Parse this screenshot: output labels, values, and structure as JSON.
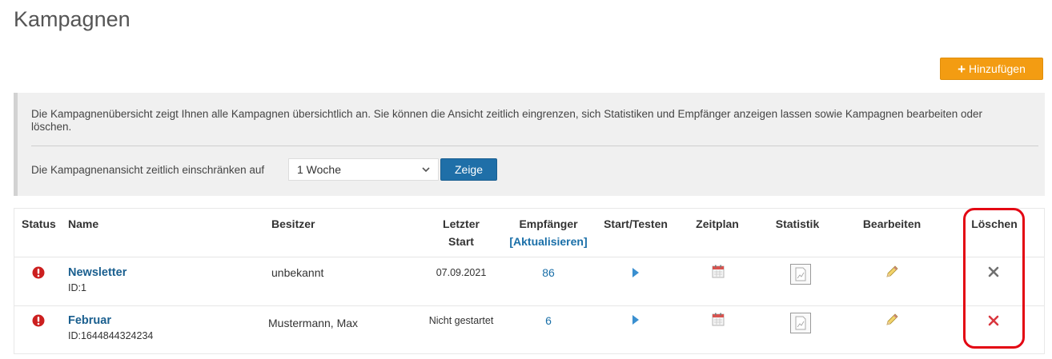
{
  "page": {
    "title": "Kampagnen"
  },
  "toolbar": {
    "add_label": "Hinzufügen"
  },
  "info": {
    "description": "Die Kampagnenübersicht zeigt Ihnen alle Kampagnen übersichtlich an. Sie können die Ansicht zeitlich eingrenzen, sich Statistiken und Empfänger anzeigen lassen sowie Kampagnen bearbeiten oder löschen.",
    "filter_label": "Die Kampagnenansicht zeitlich einschränken auf",
    "filter_value": "1 Woche",
    "show_label": "Zeige"
  },
  "table": {
    "headers": {
      "status": "Status",
      "name": "Name",
      "owner": "Besitzer",
      "last_start": "Letzter Start",
      "recipients": "Empfänger",
      "refresh": "[Aktualisieren]",
      "start_test": "Start/Testen",
      "schedule": "Zeitplan",
      "statistics": "Statistik",
      "edit": "Bearbeiten",
      "delete": "Löschen"
    },
    "rows": [
      {
        "name": "Newsletter",
        "id": "ID:1",
        "owner": "unbekannt",
        "last_start": "07.09.2021",
        "recipients": "86"
      },
      {
        "name": "Februar",
        "id": "ID:1644844324234",
        "owner": "Mustermann, Max",
        "last_start": "Nicht gestartet",
        "recipients": "6"
      }
    ]
  },
  "colors": {
    "accent": "#f39c12",
    "primary": "#1f6fa8",
    "link": "#1a5f8f",
    "status_error": "#cc1f1f",
    "highlight": "#e30613"
  },
  "icons": {
    "status": "exclamation-circle-icon",
    "start": "play-triangle-icon",
    "schedule": "calendar-icon",
    "statistics": "document-chart-icon",
    "edit": "pencil-icon",
    "delete": "x-delete-icon"
  }
}
